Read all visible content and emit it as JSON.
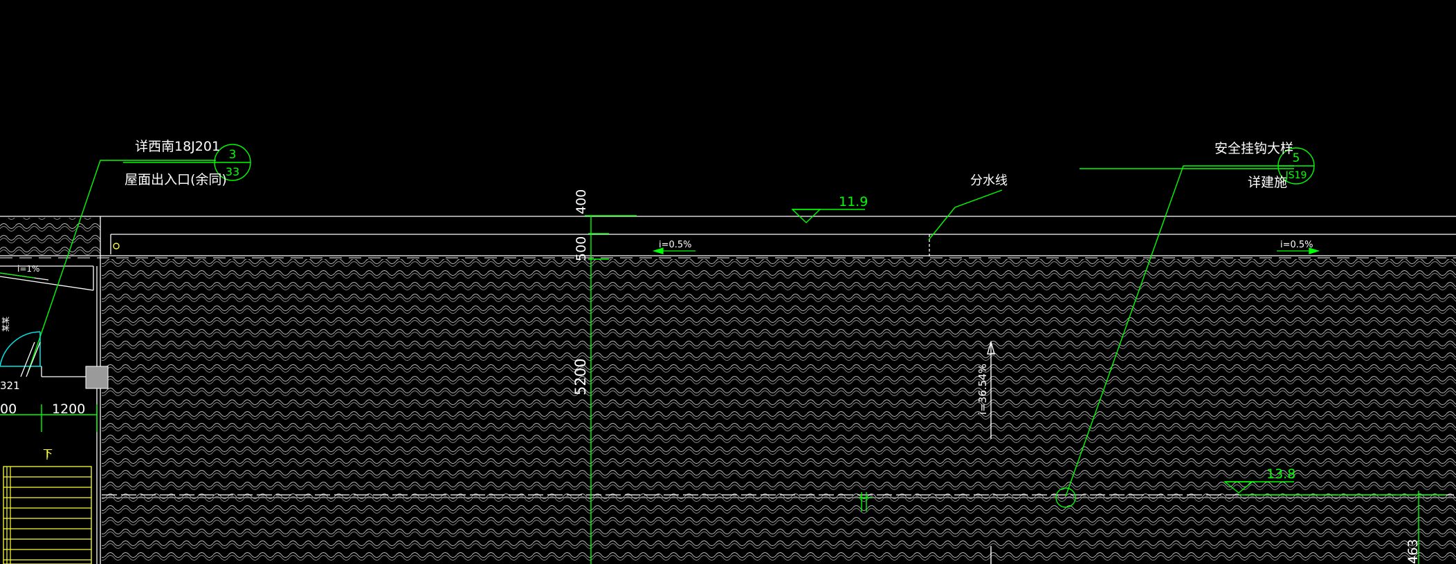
{
  "drawing": {
    "background": "#000000",
    "colors": {
      "white": "#ffffff",
      "green": "#00ff00",
      "cyan": "#00e5e5",
      "yellow": "#ffff33",
      "gray": "#a0a0a0",
      "tile": "#d8d8d8"
    },
    "annotations": {
      "ref_left_top": "详西南18J201",
      "ref_left_bottom": "屋面出入口(余同)",
      "ref_left_circle_top": "3",
      "ref_left_circle_bottom": "33",
      "ref_right_top": "安全挂钩大样",
      "ref_right_bottom": "详建施",
      "ref_right_circle_top": "5",
      "ref_right_circle_bottom": "JS19",
      "water_divide": "分水线",
      "elev_top": "11.9",
      "elev_bottom": "13.8",
      "slope_left": "i=0.5%",
      "slope_right": "i=0.5%",
      "slope_small": "i=1%",
      "slope_roof": "i=36.54%",
      "dim_400": "400",
      "dim_500": "500",
      "dim_5200": "5200",
      "dim_1200": "1200",
      "dim_00": "00",
      "label_321": "321",
      "label_down": "下",
      "label_side": "某某",
      "label_463": "463"
    }
  }
}
